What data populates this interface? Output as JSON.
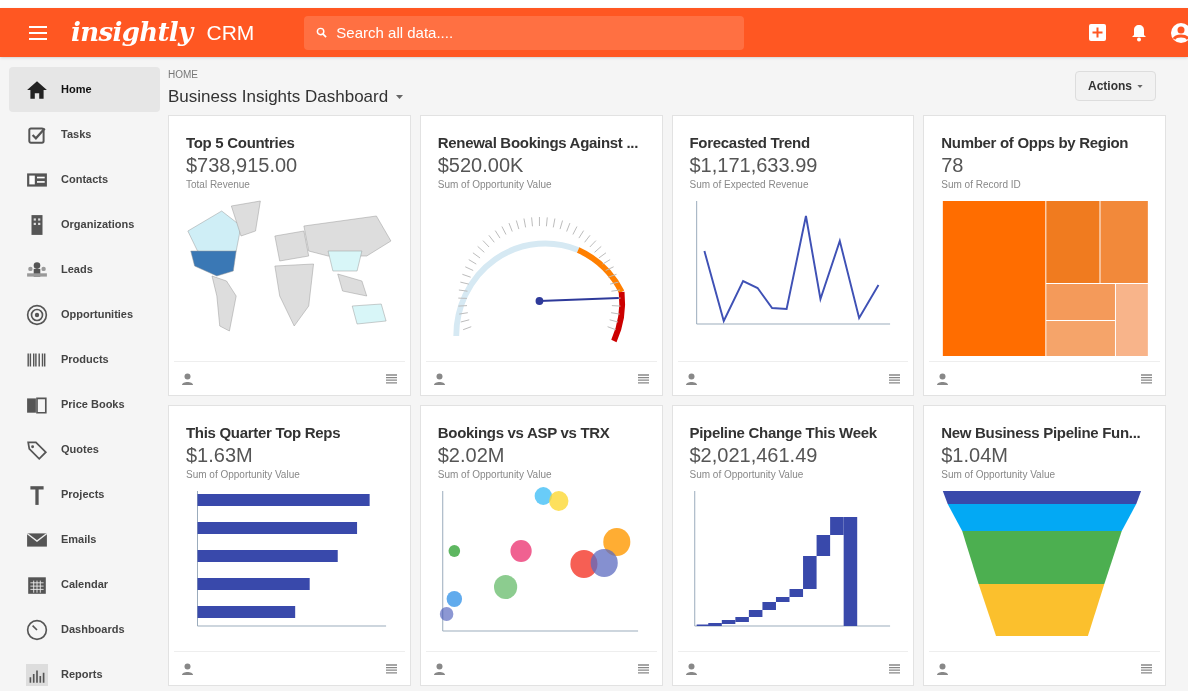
{
  "topbar": {
    "logo": "insightly",
    "product": "CRM",
    "search": {
      "placeholder": "Search all data...."
    }
  },
  "sidebar": {
    "items": [
      {
        "label": "Home",
        "selected": true
      },
      {
        "label": "Tasks",
        "selected": false
      },
      {
        "label": "Contacts",
        "selected": false
      },
      {
        "label": "Organizations",
        "selected": false
      },
      {
        "label": "Leads",
        "selected": false
      },
      {
        "label": "Opportunities",
        "selected": false
      },
      {
        "label": "Products",
        "selected": false
      },
      {
        "label": "Price Books",
        "selected": false
      },
      {
        "label": "Quotes",
        "selected": false
      },
      {
        "label": "Projects",
        "selected": false
      },
      {
        "label": "Emails",
        "selected": false
      },
      {
        "label": "Calendar",
        "selected": false
      },
      {
        "label": "Dashboards",
        "selected": false
      },
      {
        "label": "Reports",
        "selected": false
      }
    ]
  },
  "header": {
    "breadcrumb": "HOME",
    "title": "Business Insights Dashboard",
    "actions": "Actions"
  },
  "cards": [
    {
      "title": "Top 5 Countries",
      "value": "$738,915.00",
      "subtitle": "Total Revenue",
      "kind": "map"
    },
    {
      "title": "Renewal Bookings Against ...",
      "value": "$520.00K",
      "subtitle": "Sum of Opportunity Value",
      "kind": "gauge"
    },
    {
      "title": "Forecasted Trend",
      "value": "$1,171,633.99",
      "subtitle": "Sum of Expected Revenue",
      "kind": "line"
    },
    {
      "title": "Number of Opps by Region",
      "value": "78",
      "subtitle": "Sum of Record ID",
      "kind": "treemap"
    },
    {
      "title": "This Quarter Top Reps",
      "value": "$1.63M",
      "subtitle": "Sum of Opportunity Value",
      "kind": "hbar"
    },
    {
      "title": "Bookings vs ASP vs TRX",
      "value": "$2.02M",
      "subtitle": "Sum of Opportunity Value",
      "kind": "bubble"
    },
    {
      "title": "Pipeline Change This Week",
      "value": "$2,021,461.49",
      "subtitle": "Sum of Opportunity Value",
      "kind": "waterfall"
    },
    {
      "title": "New Business Pipeline Fun...",
      "value": "$1.04M",
      "subtitle": "Sum of Opportunity Value",
      "kind": "funnel"
    }
  ]
}
